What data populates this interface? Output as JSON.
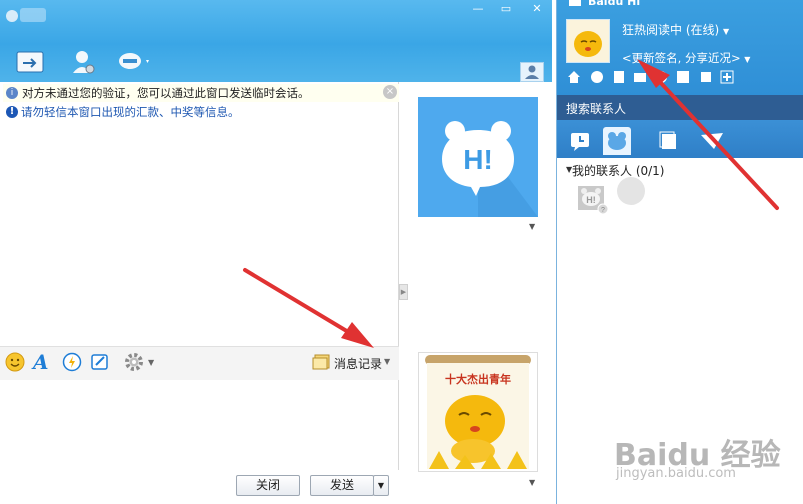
{
  "chat_window": {
    "window_buttons": {
      "minimize": "—",
      "maximize": "▭",
      "close": "✕"
    },
    "notices": [
      "对方未通过您的验证，您可以通过此窗口发送临时会话。",
      "请勿轻信本窗口出现的汇款、中奖等信息。"
    ],
    "notice_close": "×",
    "input_toolbar": {
      "icons": [
        "emoji-icon",
        "font-icon",
        "shake-icon",
        "screenshot-icon",
        "settings-icon"
      ],
      "font_glyph": "A",
      "history_label": "消息记录"
    },
    "buttons": {
      "close": "关闭",
      "send": "发送"
    },
    "side_panel": {
      "contact_avatar_text": "H!",
      "my_avatar_caption": "十大杰出青年"
    }
  },
  "hi_panel": {
    "app_title": "Baidu Hi",
    "status": "狂热阅读中 (在线)",
    "signature": "<更新签名, 分享近况>",
    "search_label": "搜索联系人",
    "tabs": [
      "recent-tab",
      "contacts-tab",
      "groups-tab",
      "discuss-tab"
    ],
    "group": {
      "name": "我的联系人 (0/1)"
    },
    "contact_avatar_text": "H!"
  },
  "watermark": {
    "brand": "Baidu 经验",
    "url": "jingyan.baidu.com"
  },
  "colors": {
    "title_blue": "#3aa6e6",
    "hi_blue": "#2f8fd6",
    "arrow_red": "#e03232"
  }
}
